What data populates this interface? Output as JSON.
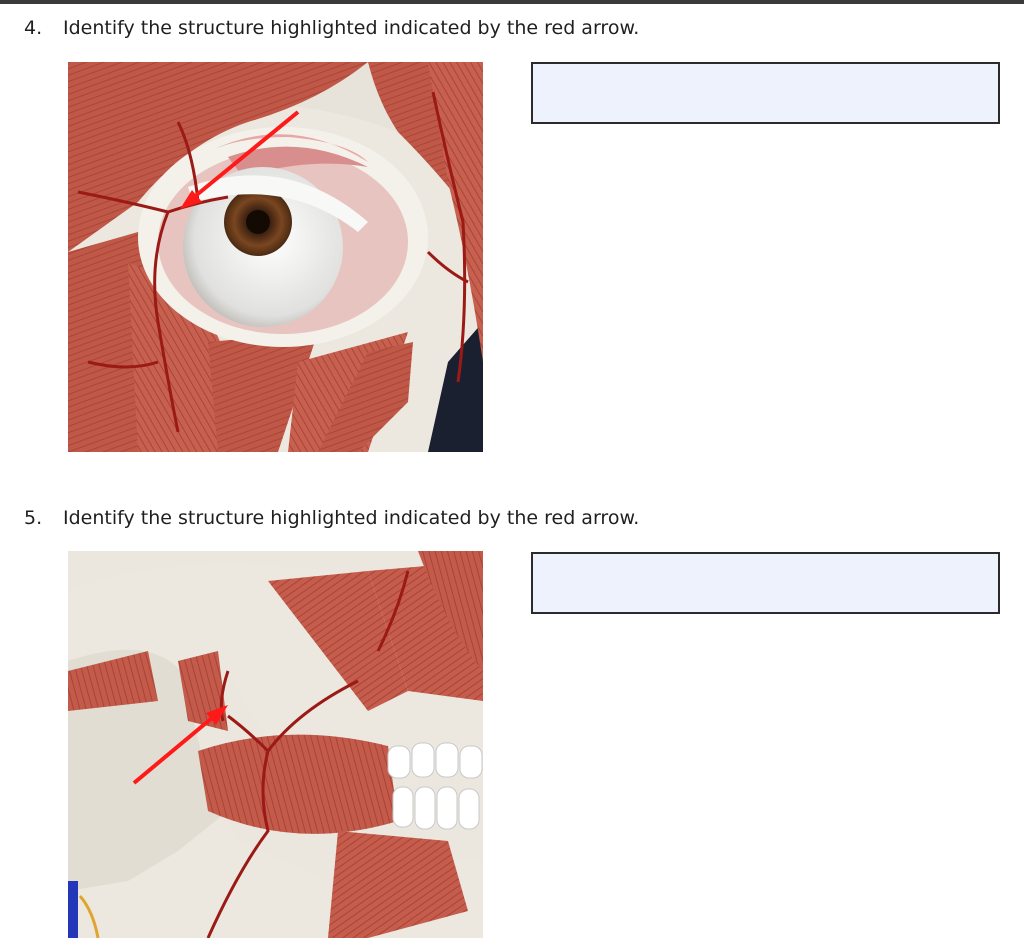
{
  "questions": [
    {
      "number": "4.",
      "prompt": "Identify the structure highlighted indicated by the red arrow.",
      "answer": "",
      "figure_icon": "anatomy-eye-orbit-image"
    },
    {
      "number": "5.",
      "prompt": "Identify the structure highlighted indicated by the red arrow.",
      "answer": "",
      "figure_icon": "anatomy-jaw-masseter-image"
    }
  ],
  "colors": {
    "arrow": "#ff1a1a",
    "answer_box_fill": "#edf2fd",
    "muscle": "#c0584a",
    "bone": "#ece8df",
    "artery": "#9b1a15"
  }
}
